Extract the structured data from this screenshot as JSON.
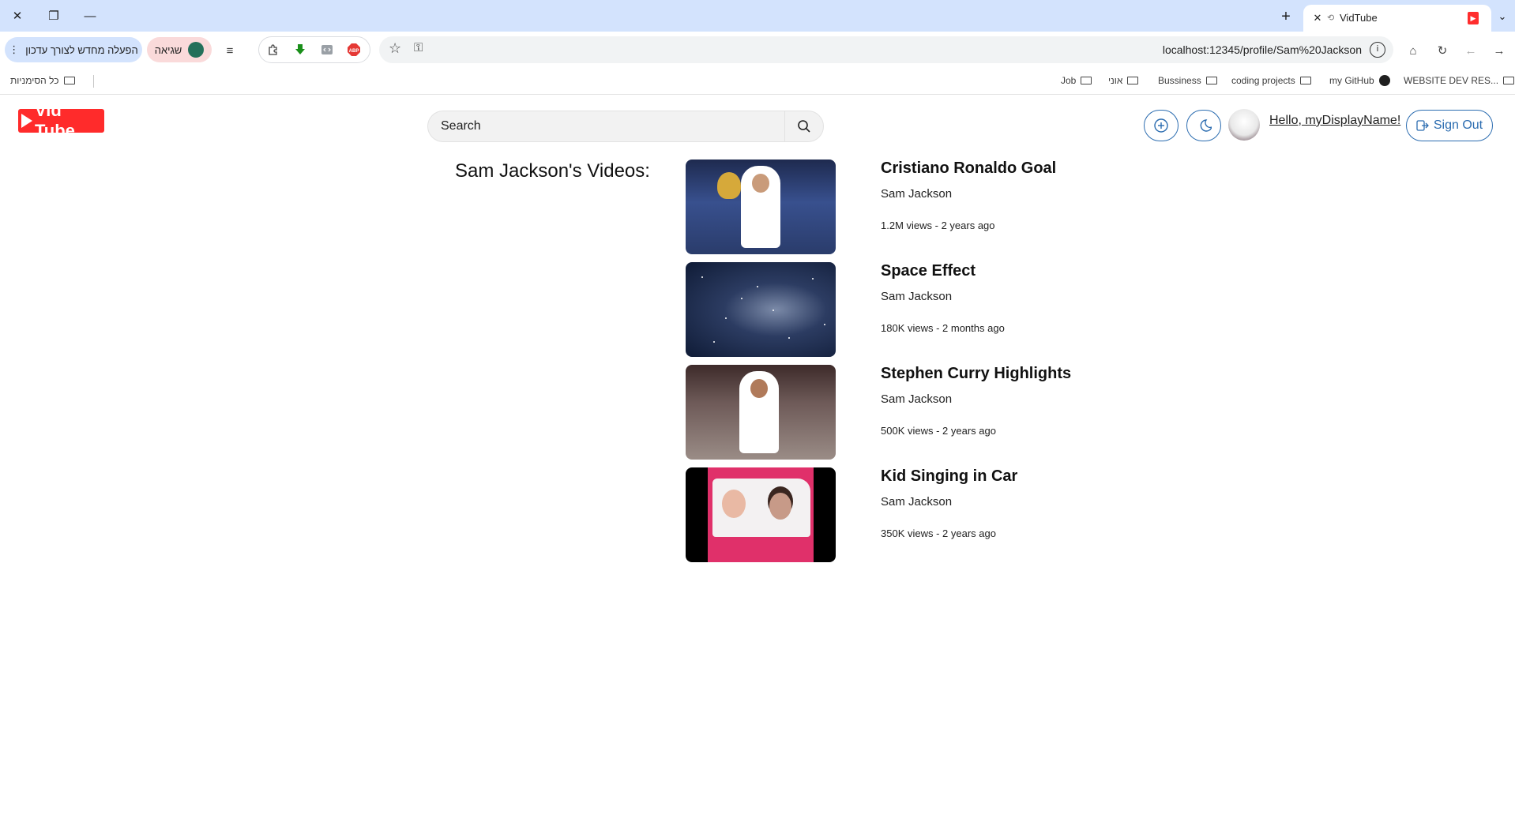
{
  "browser": {
    "tab_title": "VidTube",
    "new_tab_symbol": "+",
    "tab_close_symbol": "✕",
    "relaunch_label": "הפעלה מחדש לצורך עדכון",
    "error_label": "שגיאה",
    "url": "localhost:12345/profile/Sam%20Jackson",
    "bookmarks": {
      "all": "כל הסימניות",
      "job": "Job",
      "uni": "אוני",
      "business": "Bussiness",
      "coding": "coding projects",
      "github": "my GitHub",
      "webdev": "WEBSITE DEV RES..."
    },
    "icons": [
      "close-icon",
      "restore-icon",
      "minimize-icon",
      "reload-icon",
      "home-icon",
      "back-icon",
      "forward-icon",
      "star-icon",
      "key-icon",
      "extensions-icon",
      "download-icon"
    ]
  },
  "app": {
    "logo_text": "Vid Tube",
    "search_placeholder": "Search",
    "greeting": "Hello, myDisplayName!",
    "signout_label": "Sign Out",
    "accent_color": "#2b6cb0",
    "brand_color": "#ff2b2b"
  },
  "profile": {
    "heading": "Sam Jackson's Videos:",
    "videos": [
      {
        "title": "Cristiano Ronaldo Goal",
        "channel": "Sam Jackson",
        "meta": "1.2M views - 2 years ago"
      },
      {
        "title": "Space Effect",
        "channel": "Sam Jackson",
        "meta": "180K views - 2 months ago"
      },
      {
        "title": "Stephen Curry Highlights",
        "channel": "Sam Jackson",
        "meta": "500K views - 2 years ago"
      },
      {
        "title": "Kid Singing in Car",
        "channel": "Sam Jackson",
        "meta": "350K views - 2 years ago"
      }
    ]
  }
}
